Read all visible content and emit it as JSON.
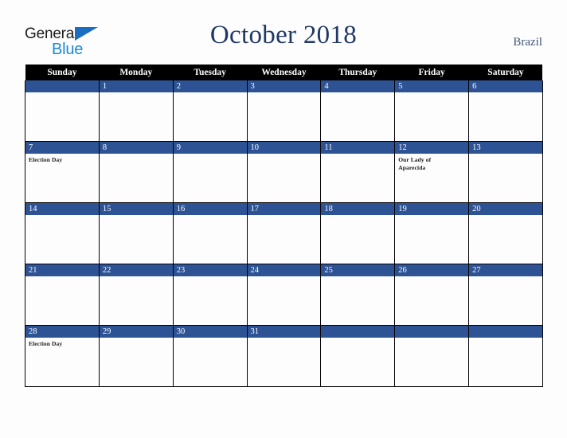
{
  "brand": {
    "word_top": "General",
    "word_bottom": "Blue",
    "triangle_color": "#1a6ec1",
    "blue_color": "#1a8ad4"
  },
  "header": {
    "title": "October 2018",
    "country": "Brazil",
    "title_color": "#1f3864",
    "country_color": "#415778"
  },
  "calendar": {
    "weekday_headers": [
      "Sunday",
      "Monday",
      "Tuesday",
      "Wednesday",
      "Thursday",
      "Friday",
      "Saturday"
    ],
    "header_bg": "#000000",
    "day_bar_bg": "#2e5395",
    "grid_border": "#000000",
    "cell_bg": "#fdfdfd",
    "weeks": [
      [
        {
          "day": "",
          "event": ""
        },
        {
          "day": "1",
          "event": ""
        },
        {
          "day": "2",
          "event": ""
        },
        {
          "day": "3",
          "event": ""
        },
        {
          "day": "4",
          "event": ""
        },
        {
          "day": "5",
          "event": ""
        },
        {
          "day": "6",
          "event": ""
        }
      ],
      [
        {
          "day": "7",
          "event": "Election Day"
        },
        {
          "day": "8",
          "event": ""
        },
        {
          "day": "9",
          "event": ""
        },
        {
          "day": "10",
          "event": ""
        },
        {
          "day": "11",
          "event": ""
        },
        {
          "day": "12",
          "event": "Our Lady of Aparecida"
        },
        {
          "day": "13",
          "event": ""
        }
      ],
      [
        {
          "day": "14",
          "event": ""
        },
        {
          "day": "15",
          "event": ""
        },
        {
          "day": "16",
          "event": ""
        },
        {
          "day": "17",
          "event": ""
        },
        {
          "day": "18",
          "event": ""
        },
        {
          "day": "19",
          "event": ""
        },
        {
          "day": "20",
          "event": ""
        }
      ],
      [
        {
          "day": "21",
          "event": ""
        },
        {
          "day": "22",
          "event": ""
        },
        {
          "day": "23",
          "event": ""
        },
        {
          "day": "24",
          "event": ""
        },
        {
          "day": "25",
          "event": ""
        },
        {
          "day": "26",
          "event": ""
        },
        {
          "day": "27",
          "event": ""
        }
      ],
      [
        {
          "day": "28",
          "event": "Election Day"
        },
        {
          "day": "29",
          "event": ""
        },
        {
          "day": "30",
          "event": ""
        },
        {
          "day": "31",
          "event": ""
        },
        {
          "day": "",
          "event": ""
        },
        {
          "day": "",
          "event": ""
        },
        {
          "day": "",
          "event": ""
        }
      ]
    ]
  }
}
